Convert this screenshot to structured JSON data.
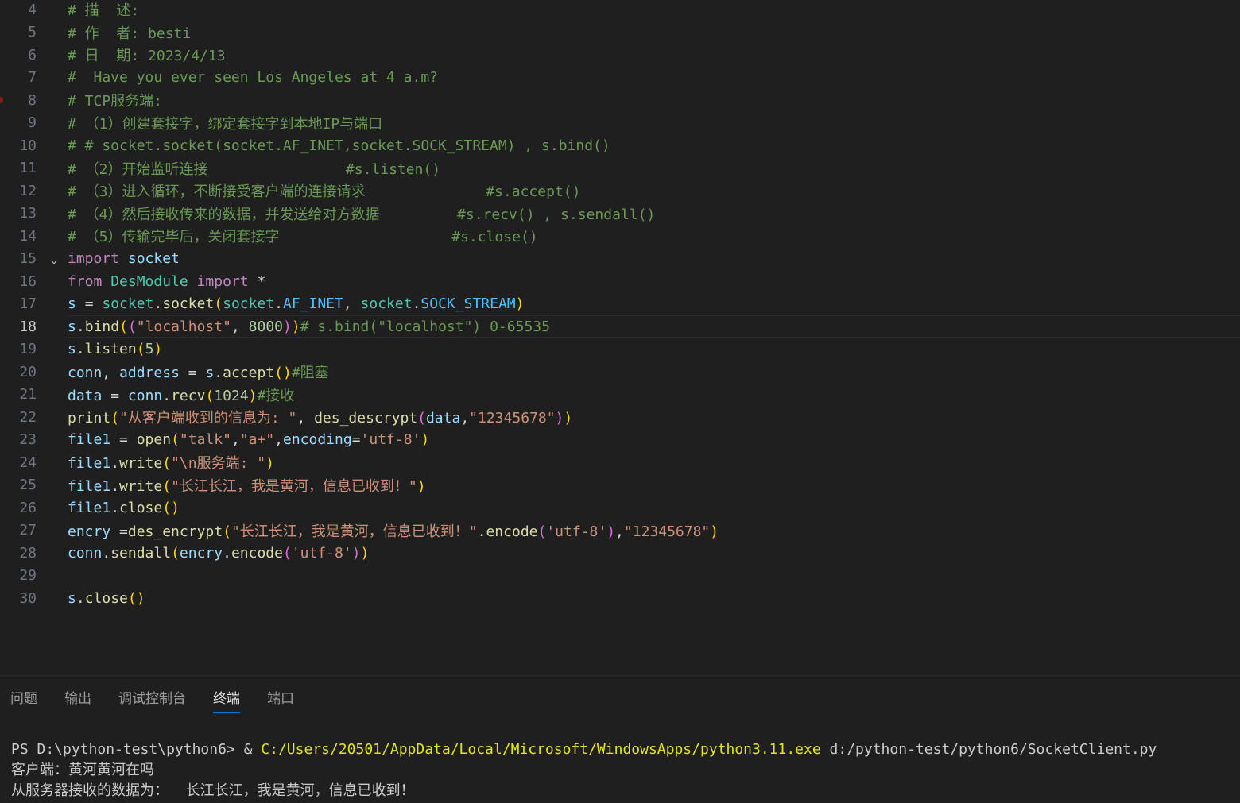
{
  "editor": {
    "current_line": "18",
    "lines": [
      {
        "n": "4",
        "text": "# 描  述:"
      },
      {
        "n": "5",
        "text": "# 作  者: besti"
      },
      {
        "n": "6",
        "text": "# 日  期: 2023/4/13"
      },
      {
        "n": "7",
        "text": "#  Have you ever seen Los Angeles at 4 a.m?"
      },
      {
        "n": "8",
        "text": "# TCP服务端:"
      },
      {
        "n": "9",
        "text": "# （1）创建套接字，绑定套接字到本地IP与端口"
      },
      {
        "n": "10",
        "text": "# # socket.socket(socket.AF_INET,socket.SOCK_STREAM) , s.bind()"
      },
      {
        "n": "11",
        "text": "# （2）开始监听连接                #s.listen()"
      },
      {
        "n": "12",
        "text": "# （3）进入循环，不断接受客户端的连接请求              #s.accept()"
      },
      {
        "n": "13",
        "text": "# （4）然后接收传来的数据，并发送给对方数据         #s.recv() , s.sendall()"
      },
      {
        "n": "14",
        "text": "# （5）传输完毕后，关闭套接字                    #s.close()"
      },
      {
        "n": "15",
        "text": "import socket"
      },
      {
        "n": "16",
        "text": "from DesModule import *"
      },
      {
        "n": "17",
        "text": "s = socket.socket(socket.AF_INET, socket.SOCK_STREAM)"
      },
      {
        "n": "18",
        "text": "s.bind((\"localhost\", 8000))# s.bind(\"localhost\") 0-65535"
      },
      {
        "n": "19",
        "text": "s.listen(5)"
      },
      {
        "n": "20",
        "text": "conn, address = s.accept()#阻塞"
      },
      {
        "n": "21",
        "text": "data = conn.recv(1024)#接收"
      },
      {
        "n": "22",
        "text": "print(\"从客户端收到的信息为: \", des_descrypt(data,\"12345678\"))"
      },
      {
        "n": "23",
        "text": "file1 = open(\"talk\",\"a+\",encoding='utf-8')"
      },
      {
        "n": "24",
        "text": "file1.write(\"\\n服务端: \")"
      },
      {
        "n": "25",
        "text": "file1.write(\"长江长江，我是黄河，信息已收到！\")"
      },
      {
        "n": "26",
        "text": "file1.close()"
      },
      {
        "n": "27",
        "text": "encry =des_encrypt(\"长江长江，我是黄河，信息已收到！\".encode('utf-8'),\"12345678\")"
      },
      {
        "n": "28",
        "text": "conn.sendall(encry.encode('utf-8'))"
      },
      {
        "n": "29",
        "text": ""
      },
      {
        "n": "30",
        "text": "s.close()"
      }
    ]
  },
  "panel": {
    "tabs": [
      "问题",
      "输出",
      "调试控制台",
      "终端",
      "端口"
    ],
    "active_tab": "终端"
  },
  "terminal": {
    "prompt": "PS D:\\python-test\\python6> ",
    "amp": "& ",
    "exe": "C:/Users/20501/AppData/Local/Microsoft/WindowsApps/python3.11.exe",
    "script": " d:/python-test/python6/SocketClient.py",
    "out1": "客户端：黄河黄河在吗",
    "out2": "从服务器接收的数据为：  长江长江，我是黄河，信息已收到！"
  },
  "colors": {
    "background": "#1f1f1f",
    "comment": "#6a9955",
    "keyword": "#c586c0",
    "variable": "#9cdcfe",
    "function": "#dcdcaa",
    "string": "#ce9178",
    "number": "#b5cea8",
    "accent": "#0078d4"
  }
}
